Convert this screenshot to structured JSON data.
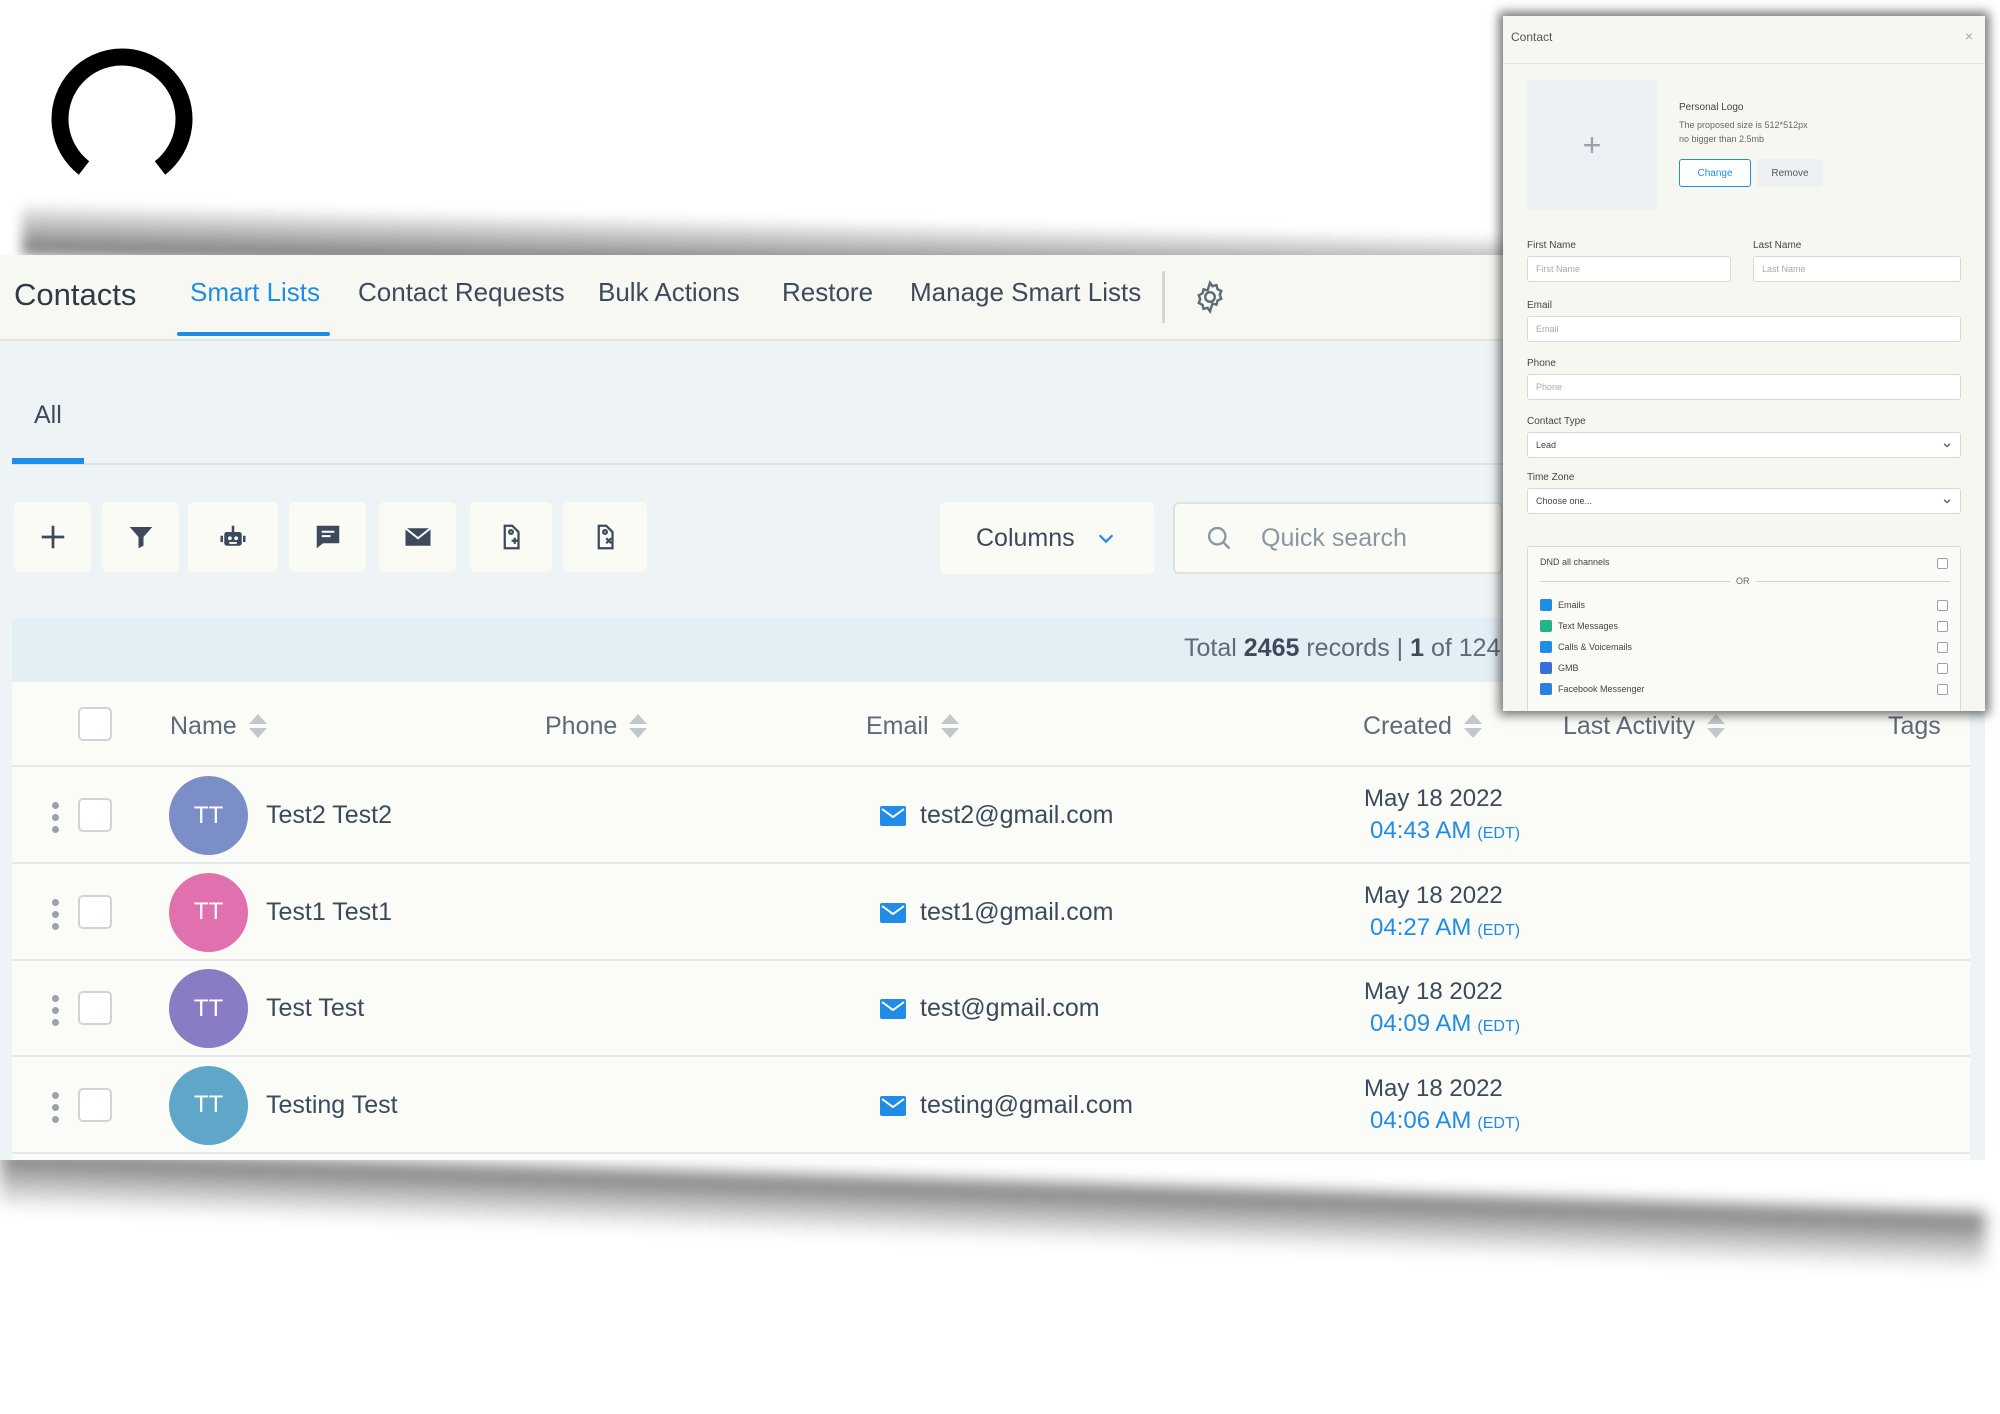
{
  "nav": {
    "title": "Contacts",
    "tabs": [
      "Smart Lists",
      "Contact Requests",
      "Bulk Actions",
      "Restore",
      "Manage Smart Lists"
    ],
    "active_tab": "Smart Lists"
  },
  "subtab": {
    "label": "All"
  },
  "toolbar": {
    "icons": [
      "add-icon",
      "filter-icon",
      "robot-icon",
      "message-icon",
      "email-icon",
      "tag-add-icon",
      "tag-remove-icon"
    ],
    "columns_label": "Columns",
    "search_placeholder": "Quick search"
  },
  "summary": {
    "prefix": "Total",
    "total": "2465",
    "records_label": "records |",
    "page": "1",
    "of_label": "of 124"
  },
  "table": {
    "headers": {
      "name": "Name",
      "phone": "Phone",
      "email": "Email",
      "created": "Created",
      "last_activity": "Last Activity",
      "tags": "Tags"
    },
    "rows": [
      {
        "initials": "TT",
        "avatar_color": "#7b8ec8",
        "name": "Test2 Test2",
        "email": "test2@gmail.com",
        "date": "May 18 2022",
        "time": "04:43 AM",
        "tz": "(EDT)"
      },
      {
        "initials": "TT",
        "avatar_color": "#e170ae",
        "name": "Test1 Test1",
        "email": "test1@gmail.com",
        "date": "May 18 2022",
        "time": "04:27 AM",
        "tz": "(EDT)"
      },
      {
        "initials": "TT",
        "avatar_color": "#8a7cc4",
        "name": "Test Test",
        "email": "test@gmail.com",
        "date": "May 18 2022",
        "time": "04:09 AM",
        "tz": "(EDT)"
      },
      {
        "initials": "TT",
        "avatar_color": "#5fa7c8",
        "name": "Testing Test",
        "email": "testing@gmail.com",
        "date": "May 18 2022",
        "time": "04:06 AM",
        "tz": "(EDT)"
      }
    ]
  },
  "modal": {
    "title": "Contact",
    "close": "×",
    "logo_plus": "+",
    "logo_title": "Personal Logo",
    "logo_desc_1": "The proposed size is 512*512px",
    "logo_desc_2": "no bigger than 2.5mb",
    "change_label": "Change",
    "remove_label": "Remove",
    "first_name_label": "First Name",
    "first_name_placeholder": "First Name",
    "last_name_label": "Last Name",
    "last_name_placeholder": "Last Name",
    "email_label": "Email",
    "email_placeholder": "Email",
    "phone_label": "Phone",
    "phone_placeholder": "Phone",
    "contact_type_label": "Contact Type",
    "contact_type_value": "Lead",
    "time_zone_label": "Time Zone",
    "time_zone_value": "Choose one...",
    "dnd_all_label": "DND all channels",
    "or_label": "OR",
    "channels": [
      {
        "label": "Emails",
        "color": "#1f8ce8"
      },
      {
        "label": "Text Messages",
        "color": "#20b486"
      },
      {
        "label": "Calls & Voicemails",
        "color": "#1f8ce8"
      },
      {
        "label": "GMB",
        "color": "#3b6fd8"
      },
      {
        "label": "Facebook Messenger",
        "color": "#2a7fe0"
      }
    ]
  },
  "colors": {
    "accent": "#1f8ce8"
  }
}
